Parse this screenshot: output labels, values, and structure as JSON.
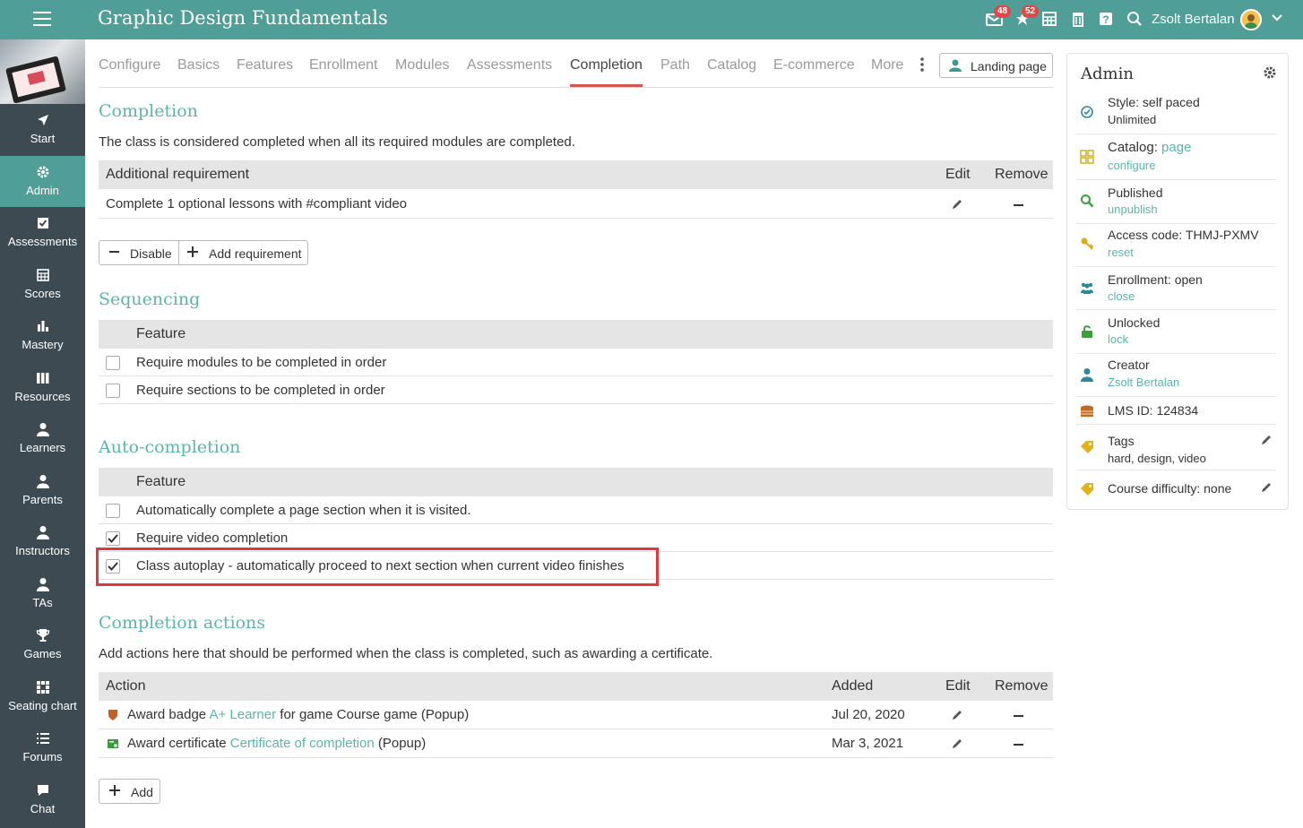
{
  "header": {
    "title": "Graphic Design Fundamentals",
    "mail_badge": "48",
    "notif_badge": "52",
    "user_name": "Zsolt Bertalan"
  },
  "sidebar": {
    "items": [
      {
        "label": "Start",
        "icon": "navigate-icon"
      },
      {
        "label": "Admin",
        "icon": "gear-icon",
        "active": true
      },
      {
        "label": "Assessments",
        "icon": "checklist-icon"
      },
      {
        "label": "Scores",
        "icon": "gradebook-icon"
      },
      {
        "label": "Mastery",
        "icon": "bar-chart-icon"
      },
      {
        "label": "Resources",
        "icon": "books-icon"
      },
      {
        "label": "Learners",
        "icon": "person-icon"
      },
      {
        "label": "Parents",
        "icon": "person-icon"
      },
      {
        "label": "Instructors",
        "icon": "person-icon"
      },
      {
        "label": "TAs",
        "icon": "person-icon"
      },
      {
        "label": "Games",
        "icon": "trophy-icon"
      },
      {
        "label": "Seating chart",
        "icon": "grid-icon"
      },
      {
        "label": "Forums",
        "icon": "list-icon"
      },
      {
        "label": "Chat",
        "icon": "chat-icon"
      }
    ]
  },
  "tabs": {
    "items": [
      "Configure",
      "Basics",
      "Features",
      "Enrollment",
      "Modules",
      "Assessments",
      "Completion",
      "Path",
      "Catalog",
      "E-commerce",
      "More"
    ],
    "active": "Completion",
    "landing_page": "Landing page"
  },
  "completion": {
    "heading": "Completion",
    "description": "The class is considered completed when all its required modules are completed.",
    "headers": {
      "requirement": "Additional requirement",
      "edit": "Edit",
      "remove": "Remove"
    },
    "rows": [
      {
        "requirement": "Complete 1 optional lessons with #compliant video"
      }
    ],
    "disable_label": "Disable",
    "add_requirement_label": "Add requirement"
  },
  "sequencing": {
    "heading": "Sequencing",
    "header": "Feature",
    "rows": [
      {
        "label": "Require modules to be completed in order",
        "checked": false
      },
      {
        "label": "Require sections to be completed in order",
        "checked": false
      }
    ]
  },
  "autocompletion": {
    "heading": "Auto-completion",
    "header": "Feature",
    "rows": [
      {
        "label": "Automatically complete a page section when it is visited.",
        "checked": false
      },
      {
        "label": "Require video completion",
        "checked": true
      },
      {
        "label": "Class autoplay - automatically proceed to next section when current video finishes",
        "checked": true
      }
    ]
  },
  "actions": {
    "heading": "Completion actions",
    "description": "Add actions here that should be performed when the class is completed, such as awarding a certificate.",
    "headers": {
      "action": "Action",
      "added": "Added",
      "edit": "Edit",
      "remove": "Remove"
    },
    "rows": [
      {
        "prefix": "Award badge ",
        "link": "A+ Learner",
        "suffix": " for game Course game (Popup)",
        "added": "Jul 20, 2020"
      },
      {
        "prefix": "Award certificate ",
        "link": "Certificate of completion",
        "suffix": " (Popup)",
        "added": "Mar 3, 2021"
      }
    ],
    "add_label": "Add"
  },
  "admin_panel": {
    "title": "Admin",
    "style_label": "Style: self paced",
    "style_value": "Unlimited",
    "catalog_label": "Catalog: ",
    "catalog_link": "page",
    "catalog_configure": "configure",
    "published_label": "Published",
    "published_link": "unpublish",
    "access_label": "Access code: THMJ-PXMV",
    "access_link": "reset",
    "enrollment_label": "Enrollment: open",
    "enrollment_link": "close",
    "unlocked_label": "Unlocked",
    "unlocked_link": "lock",
    "creator_label": "Creator",
    "creator_link": "Zsolt Bertalan",
    "lms_label": "LMS ID: 124834",
    "tags_label": "Tags",
    "tags_value": "hard, design, video",
    "difficulty_label": "Course difficulty: none"
  },
  "colors": {
    "brand": "#4f9e97",
    "sidebar": "#3d4a52",
    "link": "#5bb5ad",
    "badge": "#e04848",
    "highlight": "#e0383e"
  }
}
